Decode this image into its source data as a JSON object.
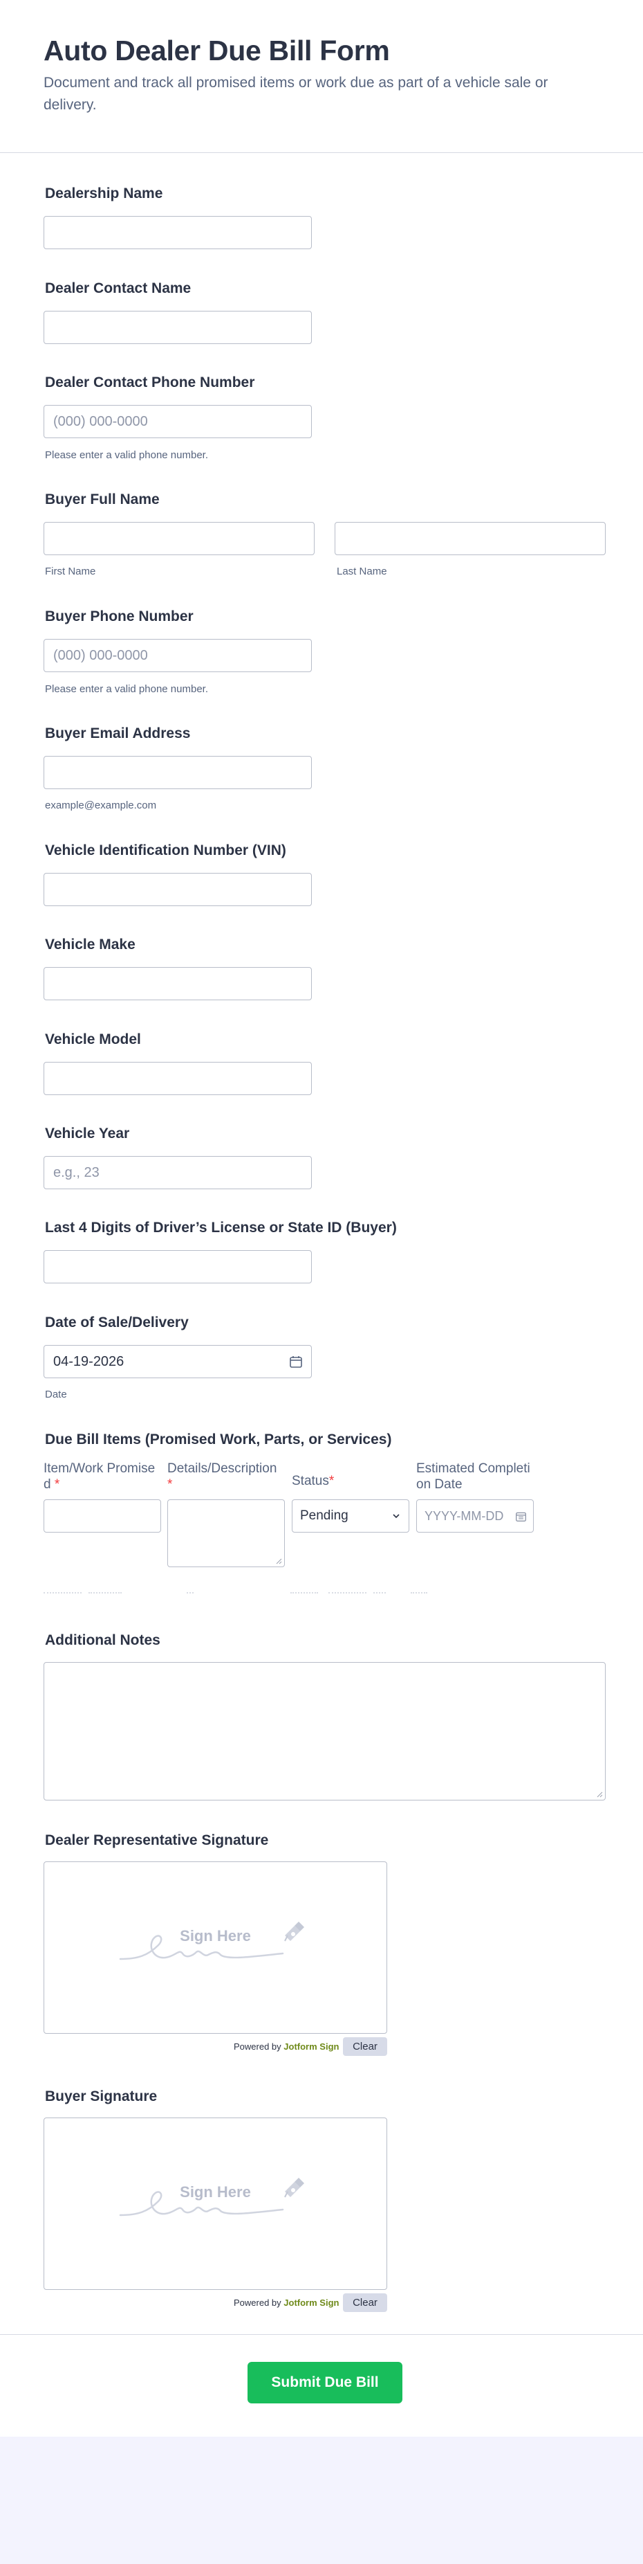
{
  "form": {
    "title": "Auto Dealer Due Bill Form",
    "subtitle": "Document and track all promised items or work due as part of a vehicle sale or delivery."
  },
  "fields": {
    "dealership_name": {
      "label": "Dealership Name",
      "value": ""
    },
    "dealer_contact_name": {
      "label": "Dealer Contact Name",
      "value": ""
    },
    "dealer_phone": {
      "label": "Dealer Contact Phone Number",
      "placeholder": "(000) 000-0000",
      "hint": "Please enter a valid phone number."
    },
    "buyer_name": {
      "label": "Buyer Full Name",
      "first_hint": "First Name",
      "last_hint": "Last Name"
    },
    "buyer_phone": {
      "label": "Buyer Phone Number",
      "placeholder": "(000) 000-0000",
      "hint": "Please enter a valid phone number."
    },
    "buyer_email": {
      "label": "Buyer Email Address",
      "hint": "example@example.com"
    },
    "vin": {
      "label": "Vehicle Identification Number (VIN)"
    },
    "make": {
      "label": "Vehicle Make"
    },
    "model": {
      "label": "Vehicle Model"
    },
    "year": {
      "label": "Vehicle Year",
      "placeholder": "e.g., 23"
    },
    "license": {
      "label": "Last 4 Digits of Driver’s License or State ID (Buyer)"
    },
    "sale_date": {
      "label": "Date of Sale/Delivery",
      "value": "04-19-2026",
      "hint": "Date"
    },
    "due_items": {
      "label": "Due Bill Items (Promised Work, Parts, or Services)",
      "columns": [
        {
          "label": "Item/Work Promised",
          "required": "*"
        },
        {
          "label": "Details/Description",
          "required": "*"
        },
        {
          "label": "Status",
          "required": "*"
        },
        {
          "label": "Estimated Completion Date",
          "required": ""
        }
      ],
      "status_value": "Pending",
      "date_placeholder": "YYYY-MM-DD"
    },
    "notes": {
      "label": "Additional Notes"
    },
    "dealer_signature": {
      "label": "Dealer Representative Signature",
      "sign_here": "Sign Here"
    },
    "buyer_signature": {
      "label": "Buyer Signature",
      "sign_here": "Sign Here"
    }
  },
  "signature_footer": {
    "powered_by": "Powered by",
    "brand": "Jotform Sign",
    "clear": "Clear"
  },
  "submit": {
    "label": "Submit Due Bill"
  },
  "colors": {
    "accent": "#18bd5b",
    "required": "#f23a3c",
    "page_bg": "#f3f3fe",
    "brand": "#6f8a1a"
  },
  "icons": [
    "calendar-icon",
    "chevron-down-icon",
    "pen-icon",
    "signature-scribble-icon",
    "resize-handle-icon"
  ]
}
